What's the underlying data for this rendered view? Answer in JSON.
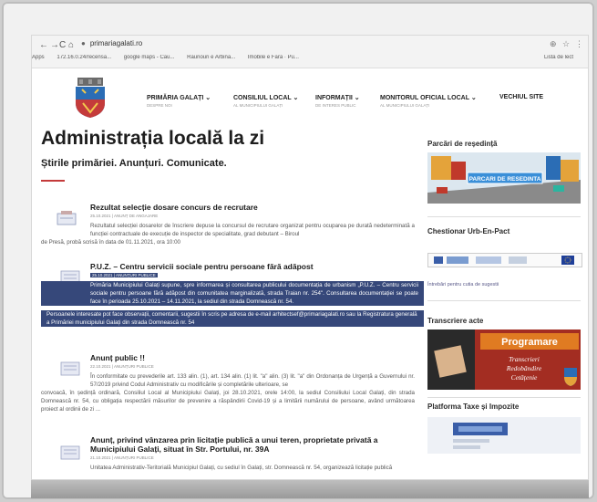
{
  "browser": {
    "url": "primariagalati.ro",
    "bookmarks": [
      "Apps",
      "172.16.0.24/recensa...",
      "google maps - Cau...",
      "Raunouri e Arbina...",
      "Imobile e Fara · Pu..."
    ],
    "bookmarks_right": "Lista de lect"
  },
  "nav": [
    {
      "label": "PRIMĂRIA GALAȚI",
      "sub": "DESPRE NOI"
    },
    {
      "label": "CONSILIUL LOCAL",
      "sub": "AL MUNICIPIULUI GALAȚI"
    },
    {
      "label": "INFORMAȚII",
      "sub": "DE INTERES PUBLIC"
    },
    {
      "label": "MONITORUL OFICIAL LOCAL",
      "sub": "AL MUNICIPIULUI GALAȚI"
    },
    {
      "label": "VECHIUL SITE",
      "sub": ""
    }
  ],
  "main": {
    "title": "Administrația locală la zi",
    "subtitle": "Știrile primăriei. Anunțuri. Comunicate."
  },
  "articles": [
    {
      "title": "Rezultat selecție dosare concurs de recrutare",
      "meta": "25.10.2021  |  ANUNȚ DE ANGAJARE",
      "body_indent": "Rezultatul selecției dosarelor de înscriere depuse la concursul de recrutare organizat pentru ocuparea pe durată nedeterminată a funcției contractuale de execuție de inspector de specialitate, grad debutant – Biroul",
      "body_rest": "de Presă, probă scrisă în data de 01.11.2021, ora 10:00"
    },
    {
      "title": "P.U.Z. – Centru servicii sociale pentru persoane fără adăpost",
      "meta": "25.10.2021  |  ANUNȚURI PUBLICE",
      "hl1": "Primăria Municipiului Galați supune, spre informarea și consultarea publicului documentația de urbanism „P.U.Z. – Centru servicii sociale pentru persoane fără adăpost din comunitatea marginalizată, strada Traian nr. 254\". Consultarea documentației se poate face în perioada 25.10.2021 – 14.11.2021, la sediul din strada Domnească nr. 54.",
      "hl2": "Persoanele interesate pot face observații, comentarii, sugestii în scris pe adresa de e-mail arhitectsef@primariagalati.ro sau la Registratura generală a Primăriei municipiului Galați din strada Domnească nr. 54"
    },
    {
      "title": "Anunț public !!",
      "meta": "22.10.2021  |  ANUNȚURI PUBLICE",
      "body_indent": "În conformitate cu prevederile art. 133 alin. (1), art. 134 alin. (1) lit. \"a\" alin. (3) lit. \"a\" din Ordonanța de Urgență a Guvernului nr. 57/2019 privind Codul Administrativ cu modificările și completările ulterioare, se",
      "body_rest": "convoacă, în ședință ordinară, Consiliul Local al Municipiului Galați, joi 28.10.2021, orele 14:00, la sediul Consiliului Local Galați, din strada Domnească nr. 54, cu obligația respectării măsurilor de prevenire a răspândirii Covid-19 și a limitării numărului de persoane, având următoarea proiect al ordinii de zi ..."
    },
    {
      "title": "Anunț, privind vânzarea prin licitație publică a unui teren, proprietate privată a Municipiului Galați, situat în Str. Portului, nr. 39A",
      "meta": "21.10.2021  |  ANUNȚURI PUBLICE",
      "body_indent": "Unitatea Administrativ-Teritorială Municipiul Galați, cu sediul în Galați, str. Domnească nr. 54, organizează licitație publică"
    }
  ],
  "sidebar": {
    "parcari_title": "Parcări de reședință",
    "parcari_banner": "PARCARI DE RESEDINTA",
    "chestionar_title": "Chestionar Urb-En-Pact",
    "chestionar_link": "Întrebări pentru cutia de sugestii",
    "transcriere_title": "Transcriere acte",
    "transcriere_banner_title": "Programare",
    "transcriere_banner_lines": [
      "Transcrieri",
      "Redobândire",
      "Cetățenie"
    ],
    "taxe_title": "Platforma Taxe și Impozite"
  },
  "colors": {
    "accent_red": "#c43b3b",
    "highlight": "#36487a",
    "banner_red": "#c0392b"
  }
}
